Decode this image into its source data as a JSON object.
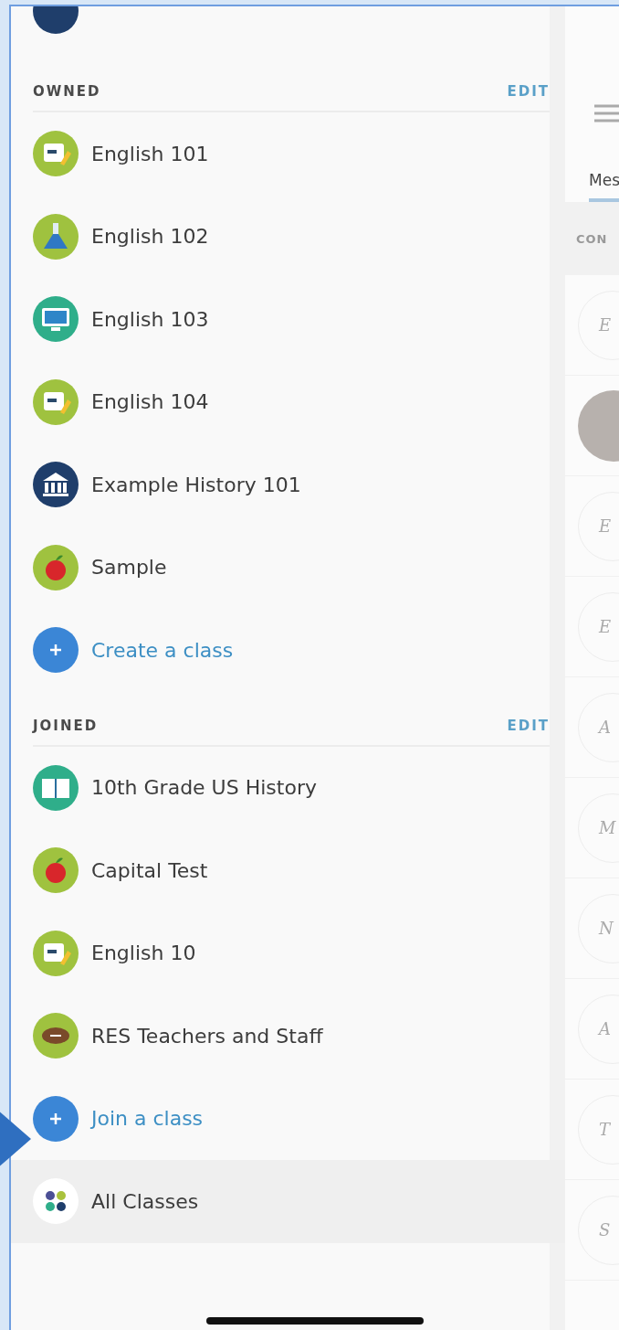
{
  "sidebar": {
    "sections": [
      {
        "title": "OWNED",
        "action": "EDIT",
        "classes": [
          {
            "name": "English 101",
            "kind": "letters"
          },
          {
            "name": "English 102",
            "kind": "flask"
          },
          {
            "name": "English 103",
            "kind": "monitor"
          },
          {
            "name": "English 104",
            "kind": "letters"
          },
          {
            "name": "Example History 101",
            "kind": "building"
          },
          {
            "name": "Sample",
            "kind": "apple"
          }
        ],
        "add_link": "Create a class"
      },
      {
        "title": "JOINED",
        "action": "EDIT",
        "classes": [
          {
            "name": "10th Grade US History",
            "kind": "book"
          },
          {
            "name": "Capital Test",
            "kind": "apple"
          },
          {
            "name": "English 10",
            "kind": "letters"
          },
          {
            "name": "RES Teachers and Staff",
            "kind": "football"
          }
        ],
        "add_link": "Join a class"
      }
    ],
    "all_classes": {
      "label": "All Classes",
      "selected": true
    }
  },
  "content": {
    "tabs": [
      {
        "label": "Mes",
        "selected": true
      }
    ],
    "section_header": "CON",
    "members": [
      {
        "kind": "initial",
        "initial": "E"
      },
      {
        "kind": "photo"
      },
      {
        "kind": "initial",
        "initial": "E"
      },
      {
        "kind": "initial",
        "initial": "E"
      },
      {
        "kind": "initial",
        "initial": "A"
      },
      {
        "kind": "initial",
        "initial": "M"
      },
      {
        "kind": "initial",
        "initial": "N"
      },
      {
        "kind": "initial",
        "initial": "A"
      },
      {
        "kind": "initial",
        "initial": "T"
      },
      {
        "kind": "initial",
        "initial": "S"
      }
    ]
  }
}
